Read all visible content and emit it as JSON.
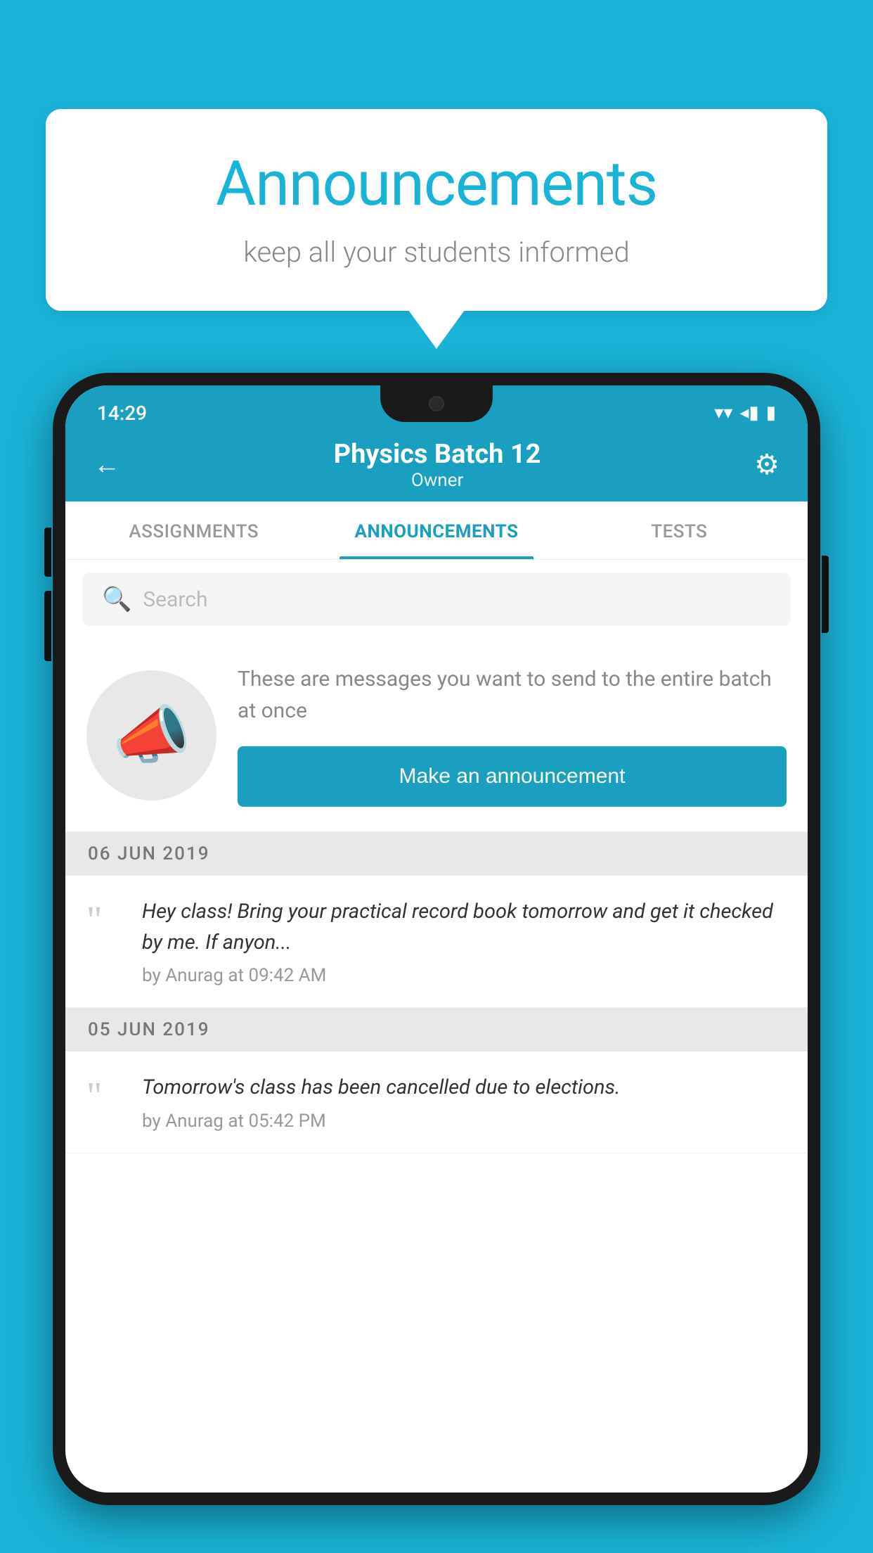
{
  "background": {
    "color": "#1ab3d8"
  },
  "speech_bubble": {
    "title": "Announcements",
    "subtitle": "keep all your students informed"
  },
  "status_bar": {
    "time": "14:29",
    "wifi_icon": "▼",
    "signal_icon": "◀",
    "battery_icon": "▮"
  },
  "header": {
    "back_icon": "←",
    "title": "Physics Batch 12",
    "subtitle": "Owner",
    "gear_icon": "⚙"
  },
  "tabs": [
    {
      "label": "ASSIGNMENTS",
      "active": false
    },
    {
      "label": "ANNOUNCEMENTS",
      "active": true
    },
    {
      "label": "TESTS",
      "active": false
    }
  ],
  "search": {
    "placeholder": "Search"
  },
  "announcement_intro": {
    "description": "These are messages you want to send to the entire batch at once",
    "button_label": "Make an announcement"
  },
  "announcements": [
    {
      "date": "06  JUN  2019",
      "text": "Hey class! Bring your practical record book tomorrow and get it checked by me. If anyon...",
      "meta": "by Anurag at 09:42 AM"
    },
    {
      "date": "05  JUN  2019",
      "text": "Tomorrow's class has been cancelled due to elections.",
      "meta": "by Anurag at 05:42 PM"
    }
  ]
}
